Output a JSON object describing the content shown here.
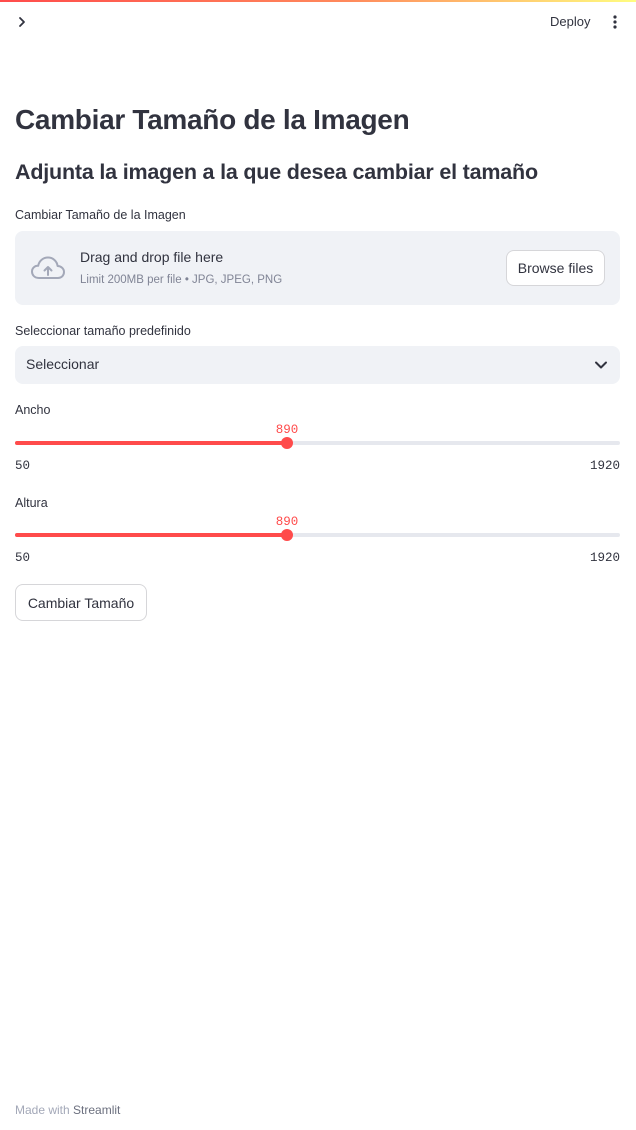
{
  "header": {
    "deploy_label": "Deploy",
    "icons": {
      "sidebar_toggle": "chevron-right-icon",
      "menu": "kebab-menu-icon"
    }
  },
  "main": {
    "title": "Cambiar Tamaño de la Imagen",
    "subtitle": "Adjunta la imagen a la que desea cambiar el tamaño",
    "uploader": {
      "label": "Cambiar Tamaño de la Imagen",
      "drop_text": "Drag and drop file here",
      "limit_text": "Limit 200MB per file • JPG, JPEG, PNG",
      "browse_label": "Browse files",
      "icon": "cloud-upload-icon"
    },
    "preset_select": {
      "label": "Seleccionar tamaño predefinido",
      "value": "Seleccionar",
      "icon": "chevron-down-icon"
    },
    "width_slider": {
      "label": "Ancho",
      "value": 890,
      "min": 50,
      "max": 1920
    },
    "height_slider": {
      "label": "Altura",
      "value": 890,
      "min": 50,
      "max": 1920
    },
    "resize_button_label": "Cambiar Tamaño"
  },
  "footer": {
    "prefix": "Made with",
    "link": "Streamlit"
  },
  "colors": {
    "accent": "#ff4b4b",
    "text": "#31333f",
    "widget_bg": "#f0f2f6",
    "muted": "#808495"
  }
}
